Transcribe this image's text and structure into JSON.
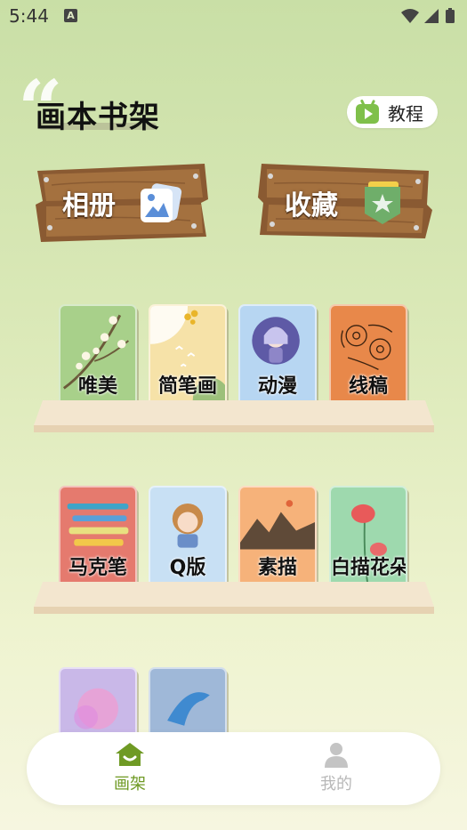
{
  "status_bar": {
    "time": "5:44",
    "notification_badge": "A"
  },
  "header": {
    "title": "画本书架",
    "tutorial_label": "教程"
  },
  "signs": [
    {
      "label": "相册",
      "icon": "photo-album-icon"
    },
    {
      "label": "收藏",
      "icon": "star-badge-icon"
    }
  ],
  "categories": [
    {
      "label": "唯美",
      "color": "#a8d08a"
    },
    {
      "label": "简笔画",
      "color": "#f6e2a8"
    },
    {
      "label": "动漫",
      "color": "#b7d6f2"
    },
    {
      "label": "线稿",
      "color": "#e8884a"
    },
    {
      "label": "马克笔",
      "color": "#e57a6e"
    },
    {
      "label": "Q版",
      "color": "#c8e0f4"
    },
    {
      "label": "素描",
      "color": "#f6b27a"
    },
    {
      "label": "白描花朵",
      "color": "#9ed9ae"
    },
    {
      "label": "",
      "color": "#c9b8e8"
    },
    {
      "label": "",
      "color": "#9fb8d8"
    }
  ],
  "bottom_nav": {
    "home_label": "画架",
    "mine_label": "我的",
    "active_color": "#6f9a24",
    "inactive_color": "#b8b8b8"
  }
}
